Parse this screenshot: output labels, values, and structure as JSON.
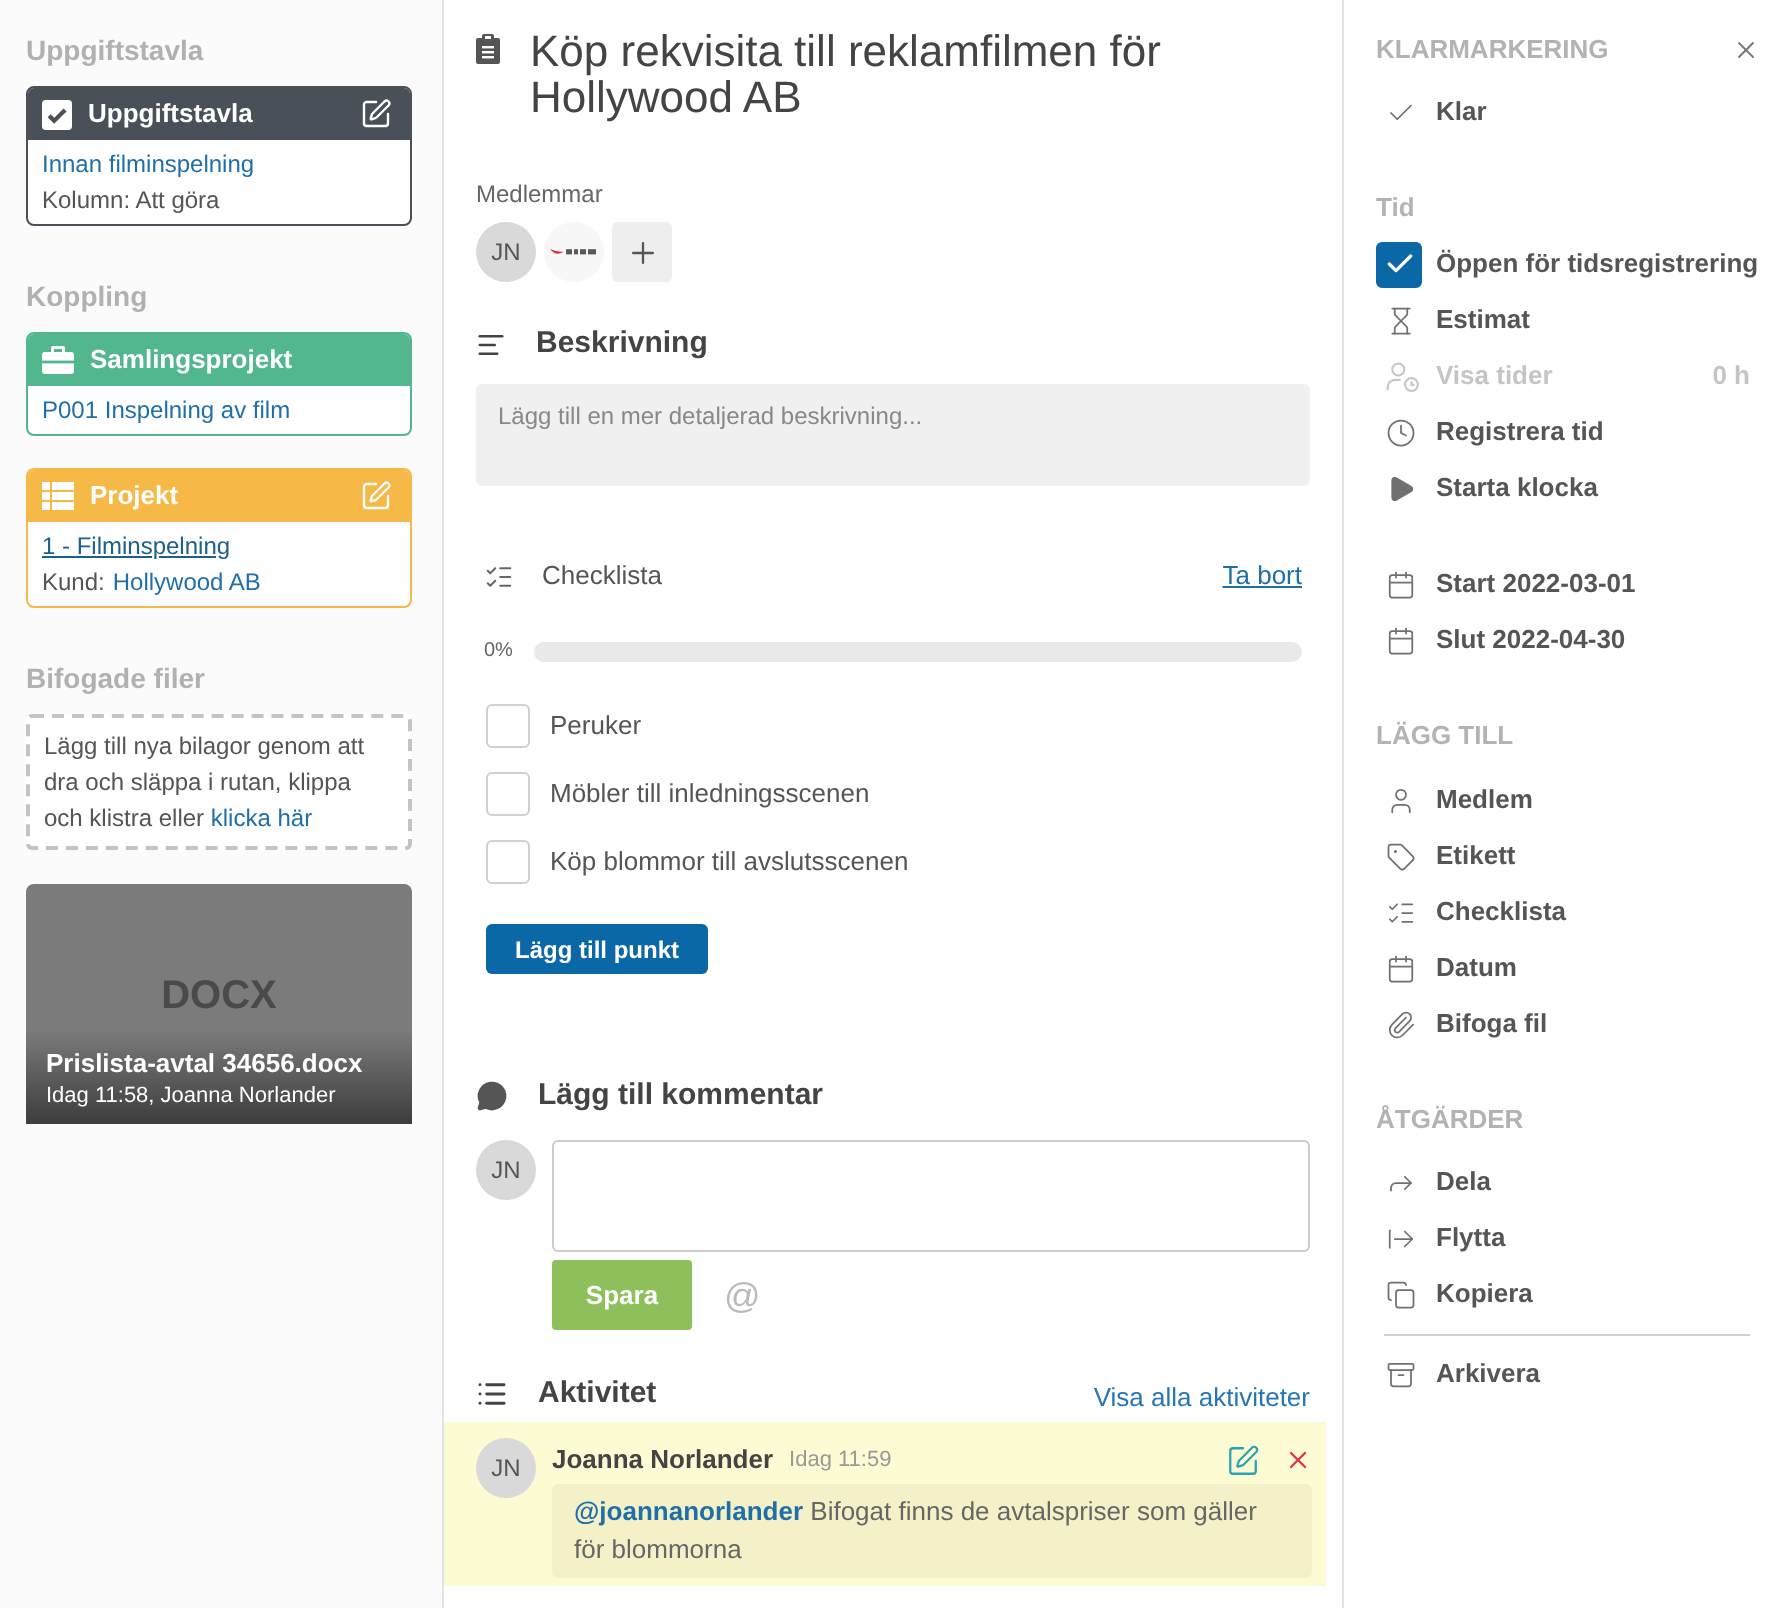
{
  "left_panel": {
    "sections": [
      {
        "heading": "Uppgiftstavla",
        "cards": [
          {
            "kind": "board",
            "title": "Uppgiftstavla",
            "color": "#4a5058",
            "editable": true,
            "lines": [
              {
                "kind": "link",
                "text": "Innan filminspelning"
              },
              {
                "kind": "text",
                "text": "Kolumn: Att göra"
              }
            ]
          }
        ]
      },
      {
        "heading": "Koppling",
        "cards": [
          {
            "kind": "collection",
            "title": "Samlingsprojekt",
            "color": "#52b78f",
            "editable": false,
            "lines": [
              {
                "kind": "link",
                "text": "P001 Inspelning av film"
              }
            ]
          },
          {
            "kind": "project",
            "title": "Projekt",
            "color": "#f6b846",
            "editable": true,
            "lines": [
              {
                "kind": "underlined_link",
                "text": "1 - Filminspelning"
              },
              {
                "kind": "labeled_link",
                "label": "Kund:",
                "text": "Hollywood AB"
              }
            ]
          }
        ]
      }
    ],
    "attachments": {
      "heading": "Bifogade filer",
      "dropzone": {
        "text": "Lägg till nya bilagor genom att dra och släppa i rutan, klippa och klistra eller",
        "link": "klicka här"
      },
      "files": [
        {
          "file_type": "DOCX",
          "name": "Prislista-avtal 34656.docx",
          "meta": "Idag 11:58, Joanna Norlander"
        }
      ]
    }
  },
  "task": {
    "title": "Köp rekvisita till reklamfilmen för Hollywood AB",
    "members": {
      "label": "Medlemmar",
      "avatars": [
        {
          "kind": "initials",
          "initials": "JN"
        },
        {
          "kind": "logo"
        }
      ]
    },
    "description": {
      "heading": "Beskrivning",
      "placeholder": "Lägg till en mer detaljerad beskrivning..."
    },
    "checklist": {
      "heading": "Checklista",
      "remove_link": "Ta bort",
      "progress_label": "0%",
      "level": 0,
      "items": [
        {
          "text": "Peruker",
          "checked": false
        },
        {
          "text": "Möbler till inledningsscenen",
          "checked": false
        },
        {
          "text": "Köp blommor till avslutsscenen",
          "checked": false
        }
      ],
      "add_button": "Lägg till punkt"
    },
    "comment": {
      "heading": "Lägg till kommentar",
      "avatar": "JN",
      "save_button": "Spara",
      "mention_button": "@"
    },
    "activity": {
      "heading": "Aktivitet",
      "show_all_link": "Visa alla aktiviteter",
      "entries": [
        {
          "avatar": "JN",
          "author": "Joanna Norlander",
          "time": "Idag 11:59",
          "mention": "@joannanorlander",
          "message": "Bifogat finns de avtalspriser som gäller för blommorna"
        }
      ]
    }
  },
  "right_panel": {
    "done_section": {
      "heading": "KLARMARKERING",
      "items": [
        {
          "label": "Klar"
        }
      ]
    },
    "time_section": {
      "heading": "Tid",
      "items": [
        {
          "kind": "checkbox",
          "label": "Öppen för tidsregistrering",
          "checked": true,
          "disabled": false
        },
        {
          "kind": "action",
          "label": "Estimat",
          "disabled": false
        },
        {
          "kind": "action",
          "label": "Visa tider",
          "value": "0 h",
          "disabled": true
        },
        {
          "kind": "action",
          "label": "Registrera tid",
          "disabled": false
        },
        {
          "kind": "action",
          "label": "Starta klocka",
          "disabled": false
        }
      ],
      "dates": [
        {
          "label": "Start 2022-03-01"
        },
        {
          "label": "Slut 2022-04-30"
        }
      ]
    },
    "add_section": {
      "heading": "LÄGG TILL",
      "items": [
        {
          "label": "Medlem"
        },
        {
          "label": "Etikett"
        },
        {
          "label": "Checklista"
        },
        {
          "label": "Datum"
        },
        {
          "label": "Bifoga fil"
        }
      ]
    },
    "actions_section": {
      "heading": "ÅTGÄRDER",
      "items": [
        {
          "label": "Dela"
        },
        {
          "label": "Flytta"
        },
        {
          "label": "Kopiera"
        }
      ],
      "archive": {
        "label": "Arkivera"
      }
    }
  }
}
